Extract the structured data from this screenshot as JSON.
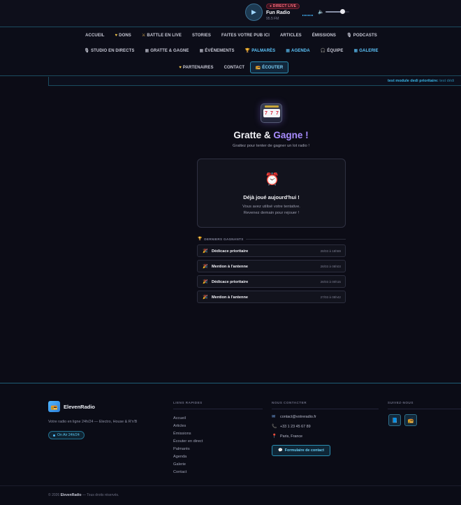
{
  "player": {
    "badge": "● DIRECT LIVE",
    "station": "Fun Radio",
    "frequency": "95.5 FM",
    "volume_percent": 70
  },
  "nav": {
    "row1": [
      {
        "label": "ACCUEIL",
        "icon": ""
      },
      {
        "label": "DONS",
        "icon": "♥"
      },
      {
        "label": "BATTLE EN LIVE",
        "icon": "⚔"
      },
      {
        "label": "STORIES",
        "icon": ""
      },
      {
        "label": "FAITES VOTRE PUB ICI",
        "icon": ""
      },
      {
        "label": "ARTICLES",
        "icon": ""
      },
      {
        "label": "ÉMISSIONS",
        "icon": ""
      },
      {
        "label": "PODCASTS",
        "icon": "🎙"
      }
    ],
    "row2": [
      {
        "label": "STUDIO EN DIRECTS",
        "icon": "🎙"
      },
      {
        "label": "GRATTE & GAGNE",
        "icon": "▦"
      },
      {
        "label": "ÉVÉNEMENTS",
        "icon": "▦"
      },
      {
        "label": "PALMARÈS",
        "icon": "🏆"
      },
      {
        "label": "AGENDA",
        "icon": "▦"
      },
      {
        "label": "ÉQUIPE",
        "icon": "🎧"
      },
      {
        "label": "GALERIE",
        "icon": "▦"
      }
    ],
    "row3": [
      {
        "label": "PARTENAIRES",
        "icon": "♥"
      },
      {
        "label": "CONTACT",
        "icon": ""
      },
      {
        "label": "ÉCOUTER",
        "icon": "📻"
      }
    ]
  },
  "ticker": {
    "label": "test module dedi prioritaire:",
    "text": "test dédi"
  },
  "hero": {
    "title_part1": "Gratte & ",
    "title_part2": "Gagne !",
    "subtitle": "Grattez pour tenter de gagner un lot radio !",
    "reels": [
      "7",
      "7",
      "7"
    ]
  },
  "played": {
    "title": "Déjà joué aujourd'hui !",
    "line1": "Vous avez utilisé votre tentative.",
    "line2": "Revenez demain pour rejouer !"
  },
  "winners": {
    "heading": "DERNIERS GAGNANTS",
    "items": [
      {
        "prize": "Dédicace prioritaire",
        "date": "28/03 à 18h59"
      },
      {
        "prize": "Mention à l'antenne",
        "date": "28/03 à 08h03"
      },
      {
        "prize": "Dédicace prioritaire",
        "date": "28/03 à 00h15"
      },
      {
        "prize": "Mention à l'antenne",
        "date": "27/03 à 08h42"
      }
    ]
  },
  "footer": {
    "brand": "ElevenRadio",
    "tagline": "Votre radio en ligne 24h/24 — Electro, House & R'n'B",
    "onair": "On Air 24h/24",
    "links_title": "LIENS RAPIDES",
    "links": [
      "Accueil",
      "Articles",
      "Émissions",
      "Écouter en direct",
      "Palmarès",
      "Agenda",
      "Galerie",
      "Contact"
    ],
    "contact_title": "NOUS CONTACTER",
    "email": "contact@votreradio.fr",
    "phone": "+33 1 23 45 67 89",
    "location": "Paris, France",
    "contact_button": "Formulaire de contact",
    "follow_title": "SUIVEZ-NOUS",
    "copyright_prefix": "© 2026",
    "copyright_brand": "ElevenRadio",
    "copyright_suffix": "— Tous droits réservés."
  }
}
